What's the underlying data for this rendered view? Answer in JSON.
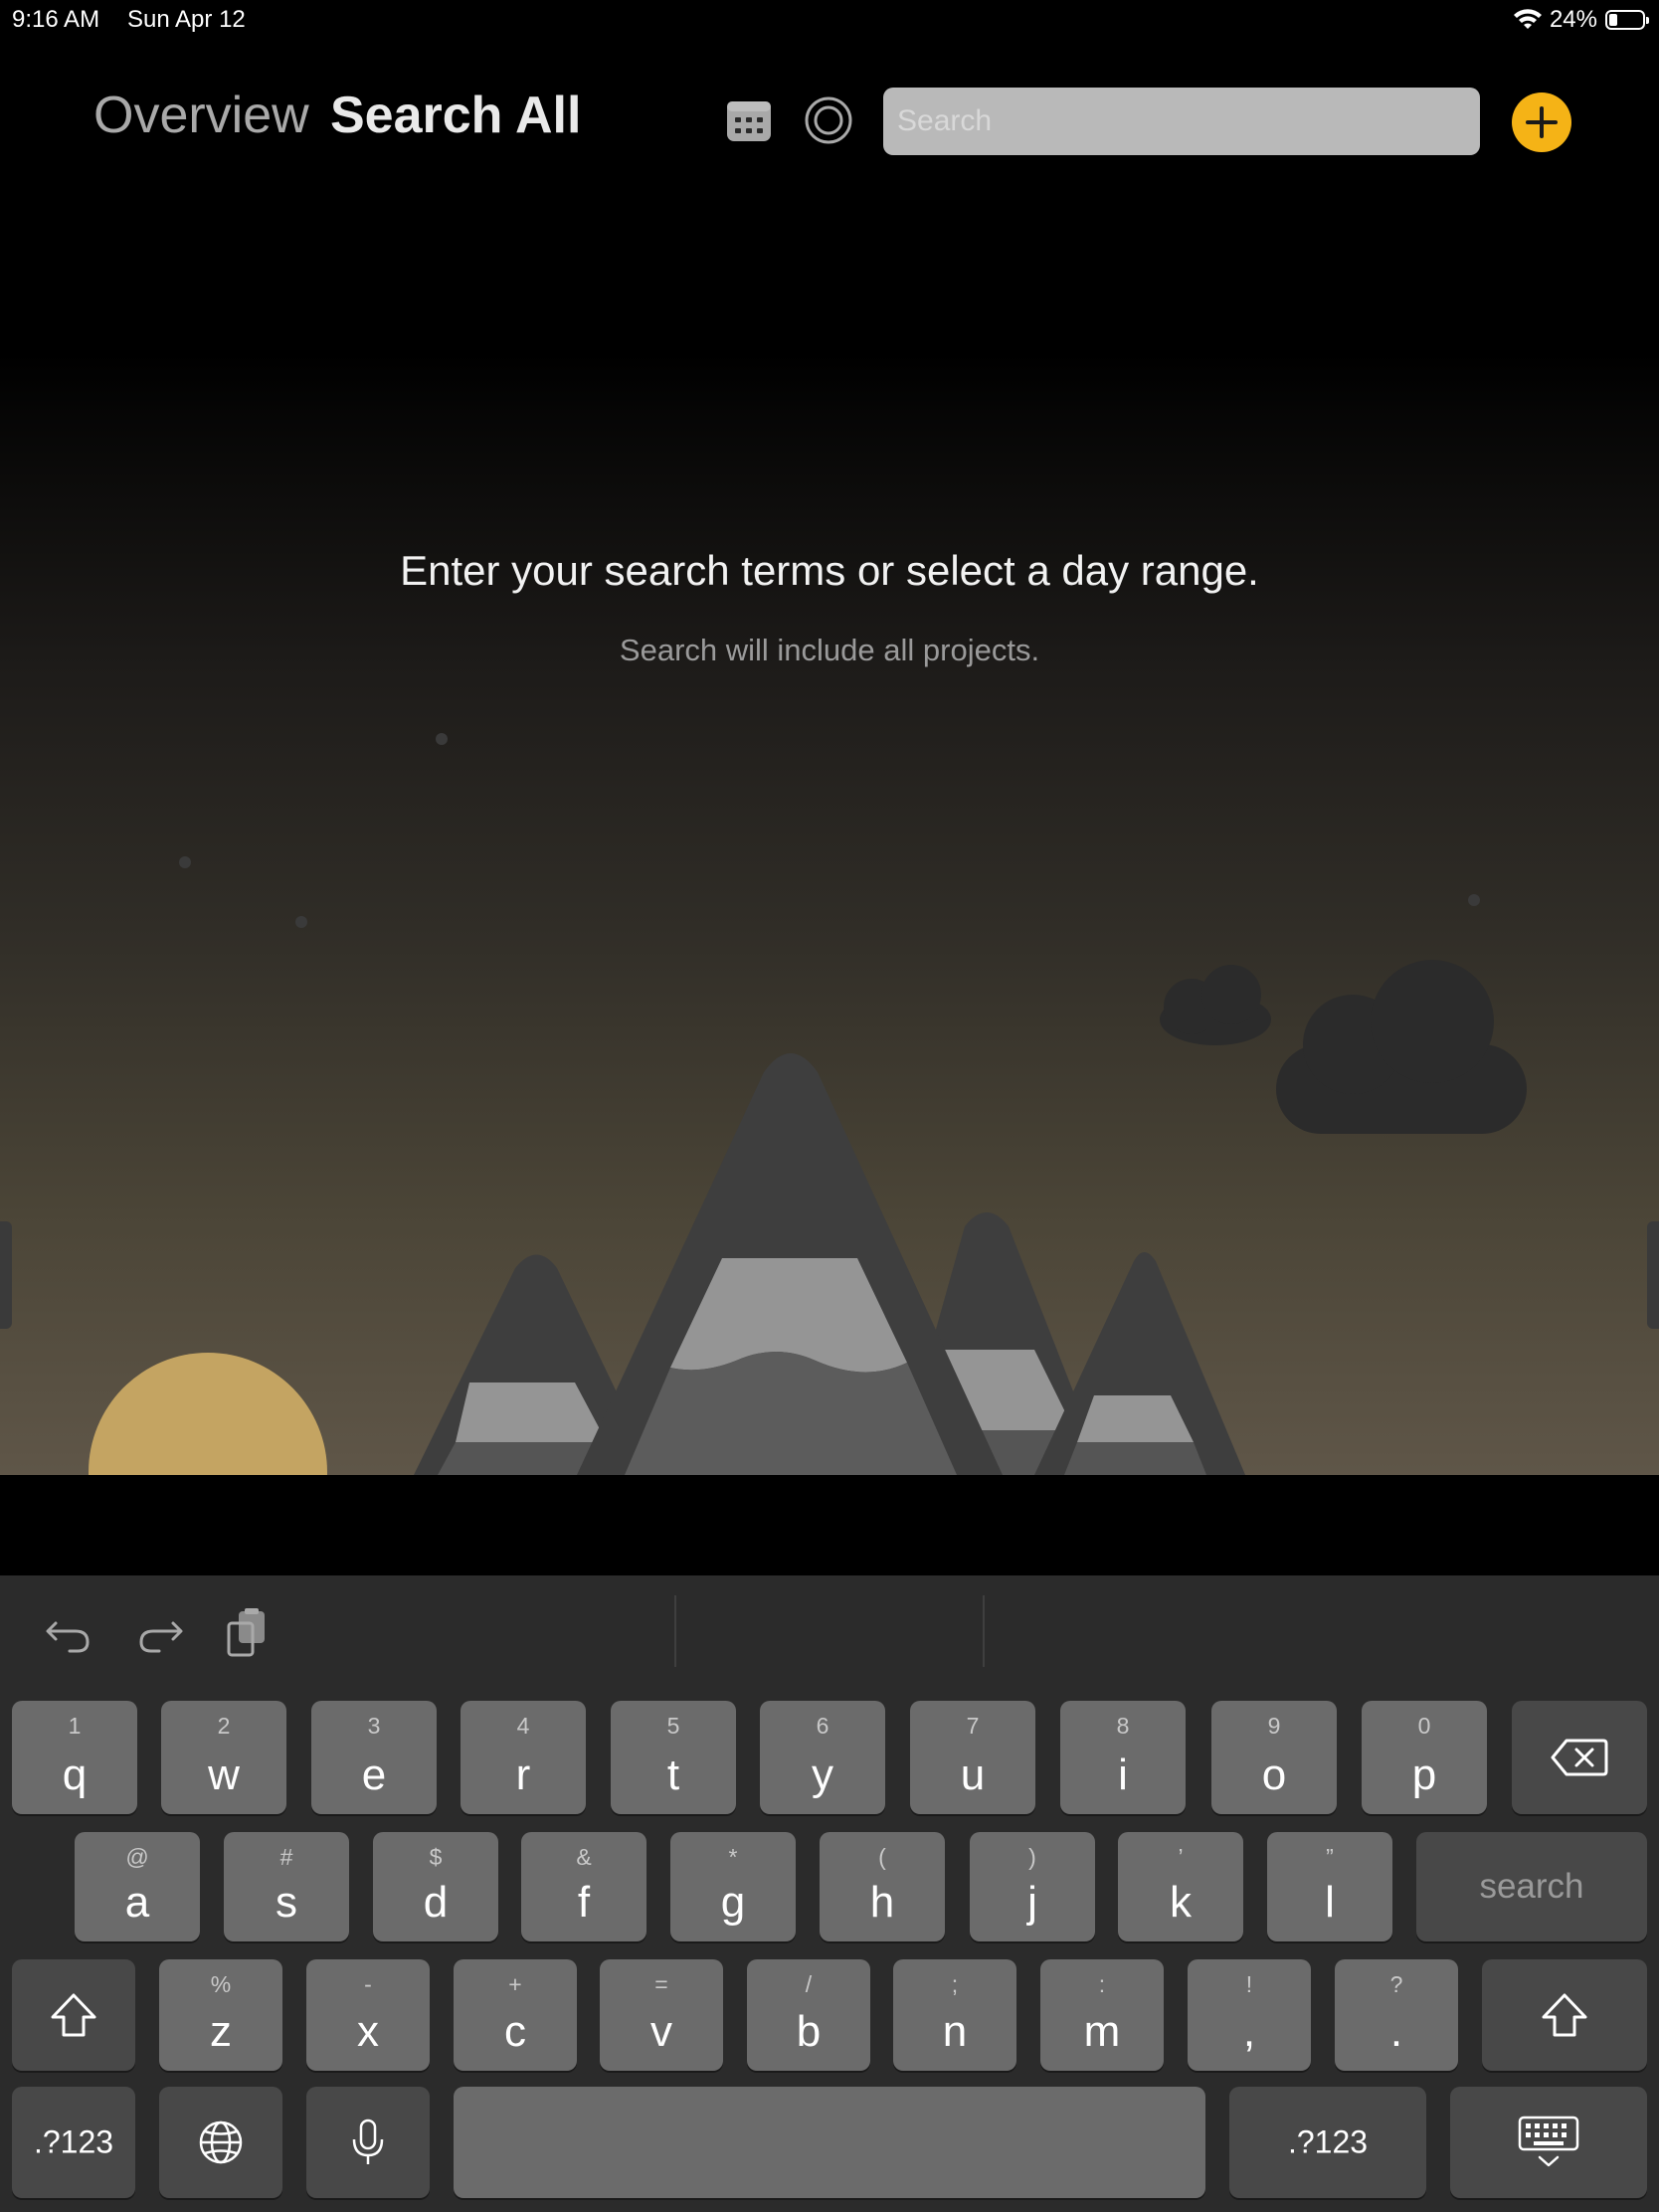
{
  "status_bar": {
    "time": "9:16 AM",
    "date": "Sun Apr 12",
    "battery_percent": "24%",
    "battery_level": 0.24,
    "wifi_icon": "wifi-icon"
  },
  "header": {
    "tab_overview": "Overview",
    "tab_search_all": "Search All",
    "calendar_icon": "calendar-icon",
    "target_icon": "target-circle-icon",
    "search_placeholder": "Search",
    "search_value": "",
    "add_icon": "plus-icon",
    "accent_color": "#f5b316"
  },
  "main": {
    "empty_title": "Enter your search terms or select a day range.",
    "empty_subtitle": "Search will include all projects."
  },
  "colors": {
    "sun": "#c4a462",
    "mountain": "#3e3e3e",
    "snow": "#959595",
    "cloud": "#2b2b2b"
  },
  "keyboard": {
    "toolbar": {
      "undo_icon": "undo-icon",
      "redo_icon": "redo-icon",
      "paste_icon": "clipboard-paste-icon"
    },
    "row1": [
      {
        "sub": "1",
        "main": "q"
      },
      {
        "sub": "2",
        "main": "w"
      },
      {
        "sub": "3",
        "main": "e"
      },
      {
        "sub": "4",
        "main": "r"
      },
      {
        "sub": "5",
        "main": "t"
      },
      {
        "sub": "6",
        "main": "y"
      },
      {
        "sub": "7",
        "main": "u"
      },
      {
        "sub": "8",
        "main": "i"
      },
      {
        "sub": "9",
        "main": "o"
      },
      {
        "sub": "0",
        "main": "p"
      }
    ],
    "row2": [
      {
        "sub": "@",
        "main": "a"
      },
      {
        "sub": "#",
        "main": "s"
      },
      {
        "sub": "$",
        "main": "d"
      },
      {
        "sub": "&",
        "main": "f"
      },
      {
        "sub": "*",
        "main": "g"
      },
      {
        "sub": "(",
        "main": "h"
      },
      {
        "sub": ")",
        "main": "j"
      },
      {
        "sub": "’",
        "main": "k"
      },
      {
        "sub": "”",
        "main": "l"
      }
    ],
    "row3": [
      {
        "sub": "%",
        "main": "z"
      },
      {
        "sub": "-",
        "main": "x"
      },
      {
        "sub": "+",
        "main": "c"
      },
      {
        "sub": "=",
        "main": "v"
      },
      {
        "sub": "/",
        "main": "b"
      },
      {
        "sub": ";",
        "main": "n"
      },
      {
        "sub": ":",
        "main": "m"
      },
      {
        "sub": "!",
        "main": ","
      },
      {
        "sub": "?",
        "main": "."
      }
    ],
    "search_label": "search",
    "numbers_label_left": ".?123",
    "numbers_label_right": ".?123",
    "backspace_icon": "backspace-icon",
    "shift_icon": "shift-icon",
    "globe_icon": "globe-icon",
    "mic_icon": "microphone-icon",
    "dismiss_icon": "keyboard-dismiss-icon"
  }
}
